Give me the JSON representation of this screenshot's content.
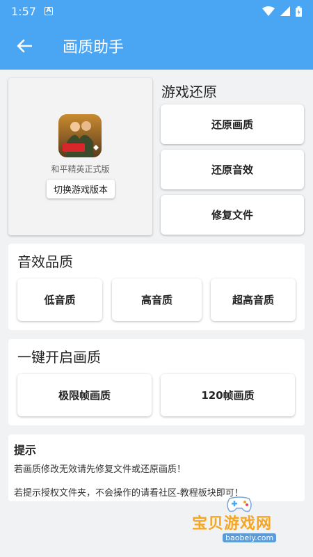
{
  "status_bar": {
    "time": "1:57",
    "notification_letter": "A"
  },
  "app_bar": {
    "title": "画质助手"
  },
  "game": {
    "name": "和平精英正式版",
    "switch_label": "切换游戏版本"
  },
  "restore": {
    "title": "游戏还原",
    "buttons": [
      "还原画质",
      "还原音效",
      "修复文件"
    ]
  },
  "audio": {
    "title": "音效品质",
    "buttons": [
      "低音质",
      "高音质",
      "超高音质"
    ]
  },
  "quality": {
    "title": "一键开启画质",
    "buttons": [
      "极限帧画质",
      "120帧画质"
    ]
  },
  "hint": {
    "title": "提示",
    "lines": [
      "若画质修改无效请先修复文件或还原画质！",
      "若提示授权文件夹，不会操作的请看社区-教程板块即可！"
    ]
  },
  "watermark": {
    "text": "宝贝游戏网",
    "url": "baobeiy.com"
  },
  "colors": {
    "primary": "#4aa5f3",
    "background": "#f1f2f4"
  }
}
